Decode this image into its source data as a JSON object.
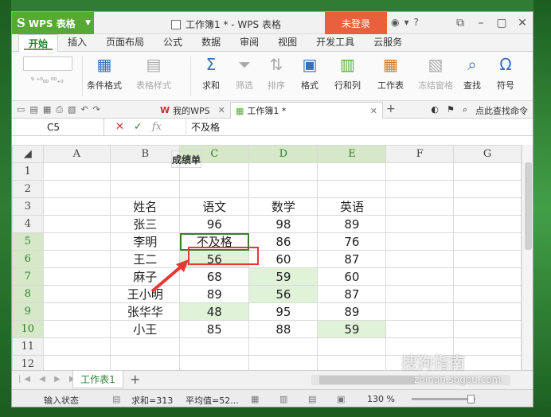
{
  "titlebar": {
    "app_name": "WPS 表格",
    "window_title": "工作簿1 * - WPS 表格",
    "login_label": "未登录",
    "help_label": "?"
  },
  "menu": {
    "tabs": [
      "开始",
      "插入",
      "页面布局",
      "公式",
      "数据",
      "审阅",
      "视图",
      "开发工具",
      "云服务"
    ]
  },
  "ribbon": {
    "items": [
      {
        "label": "条件格式",
        "icon": "conditional-format-icon",
        "dim": false
      },
      {
        "label": "表格样式",
        "icon": "table-style-icon",
        "dim": true
      },
      {
        "label": "求和",
        "icon": "sum-icon",
        "dim": false
      },
      {
        "label": "筛选",
        "icon": "filter-icon",
        "dim": true
      },
      {
        "label": "排序",
        "icon": "sort-icon",
        "dim": true
      },
      {
        "label": "格式",
        "icon": "format-icon",
        "dim": false
      },
      {
        "label": "行和列",
        "icon": "rows-cols-icon",
        "dim": false
      },
      {
        "label": "工作表",
        "icon": "worksheet-icon",
        "dim": false
      },
      {
        "label": "冻结窗格",
        "icon": "freeze-icon",
        "dim": true
      },
      {
        "label": "查找",
        "icon": "find-icon",
        "dim": false
      },
      {
        "label": "符号",
        "icon": "symbol-icon",
        "dim": false
      }
    ]
  },
  "doctabs": {
    "mywps": "我的WPS",
    "workbook": "工作簿1 *",
    "search": "点此查找命令"
  },
  "formula": {
    "cell_ref": "C5",
    "value": "不及格"
  },
  "sheet": {
    "columns": [
      "A",
      "B",
      "C",
      "D",
      "E",
      "F",
      "G"
    ],
    "rows": [
      {
        "n": "1",
        "cells": [
          "",
          "",
          "",
          "",
          "",
          "",
          ""
        ]
      },
      {
        "n": "2",
        "cells": [
          "",
          "",
          "成绩单",
          "",
          "",
          "",
          ""
        ]
      },
      {
        "n": "3",
        "cells": [
          "",
          "姓名",
          "语文",
          "数学",
          "英语",
          "",
          ""
        ]
      },
      {
        "n": "4",
        "cells": [
          "",
          "张三",
          "96",
          "98",
          "89",
          "",
          ""
        ]
      },
      {
        "n": "5",
        "cells": [
          "",
          "李明",
          "不及格",
          "86",
          "76",
          "",
          ""
        ]
      },
      {
        "n": "6",
        "cells": [
          "",
          "王二",
          "56",
          "60",
          "87",
          "",
          ""
        ]
      },
      {
        "n": "7",
        "cells": [
          "",
          "麻子",
          "68",
          "59",
          "60",
          "",
          ""
        ]
      },
      {
        "n": "8",
        "cells": [
          "",
          "王小明",
          "89",
          "56",
          "87",
          "",
          ""
        ]
      },
      {
        "n": "9",
        "cells": [
          "",
          "张华华",
          "48",
          "95",
          "89",
          "",
          ""
        ]
      },
      {
        "n": "10",
        "cells": [
          "",
          "小王",
          "85",
          "88",
          "59",
          "",
          ""
        ]
      },
      {
        "n": "11",
        "cells": [
          "",
          "",
          "",
          "",
          "",
          "",
          ""
        ]
      },
      {
        "n": "12",
        "cells": [
          "",
          "",
          "",
          "",
          "",
          "",
          ""
        ]
      }
    ],
    "highlight_color": "#e0f2d8"
  },
  "sheettabs": {
    "active": "工作表1"
  },
  "status": {
    "mode": "输入状态",
    "sum": "求和=313",
    "avg": "平均值=52...",
    "zoom": "130 %"
  },
  "watermark": {
    "text": "搜狗指南",
    "url": "zhinan.sogou.com"
  }
}
